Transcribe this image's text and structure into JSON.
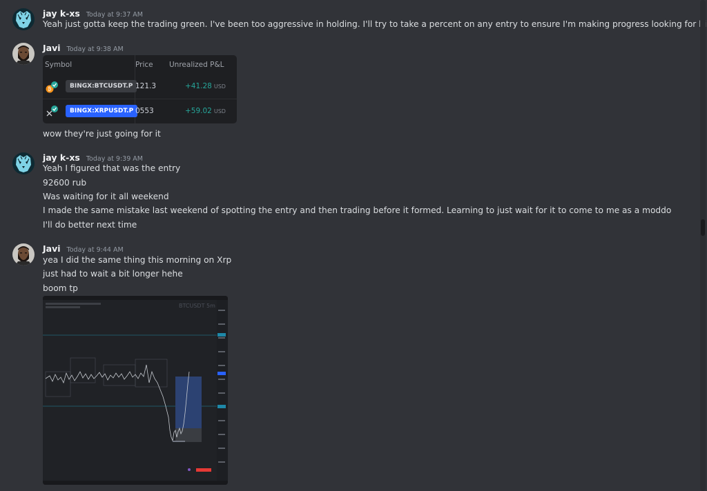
{
  "messages": [
    {
      "author": "jay k-xs",
      "time": "Today at 9:37 AM",
      "lines": [
        "Yeah just gotta keep the trading green. I've been too aggressive in holding. I'll try to take a percent on any entry to ensure I'm making progress looking for big trades"
      ]
    },
    {
      "author": "Javi",
      "time": "Today at 9:38 AM",
      "lines": [
        "wow they're just going for it"
      ],
      "embed": {
        "headers": {
          "symbol": "Symbol",
          "price": "Price",
          "pnl": "Unrealized P&L"
        },
        "rows": [
          {
            "symbol": "BINGX:BTCUSDT.P",
            "price": "121.3",
            "pnl": "+41.28",
            "unit": "USD"
          },
          {
            "symbol": "BINGX:XRPUSDT.P",
            "price": "0553",
            "pnl": "+59.02",
            "unit": "USD"
          }
        ]
      }
    },
    {
      "author": "jay k-xs",
      "time": "Today at 9:39 AM",
      "lines": [
        "Yeah I figured that was the entry",
        "92600 rub",
        "Was waiting for it all weekend",
        "I made the same mistake last weekend of spotting the entry and then trading before it formed. Learning to just wait for it to come to me as a moddo",
        "I'll do better next time"
      ]
    },
    {
      "author": "Javi",
      "time": "Today at 9:44 AM",
      "lines": [
        "yea I did the same thing this morning on Xrp",
        "just had to wait a bit longer hehe",
        "boom tp"
      ],
      "image": {
        "watermark": "BTCUSDT 5m"
      }
    }
  ],
  "colors": {
    "background": "#313338",
    "pnl_positive": "#26a69a",
    "symbol_active": "#2962ff"
  },
  "icons": {
    "avatar_1": "tiger-avatar-icon",
    "avatar_2": "bearded-man-avatar-icon",
    "btc": "bitcoin-icon",
    "xrp": "xrp-icon"
  }
}
